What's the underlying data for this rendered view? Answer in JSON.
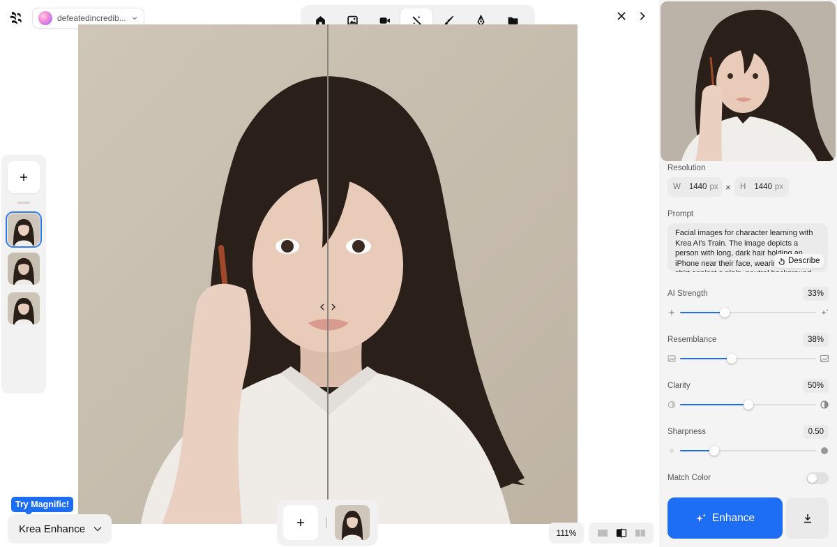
{
  "workspace": {
    "name": "defeatedincredib..."
  },
  "toolbar": {
    "tools": [
      {
        "icon": "home-icon",
        "active": false
      },
      {
        "icon": "image-icon",
        "active": false
      },
      {
        "icon": "video-icon",
        "active": false
      },
      {
        "icon": "enhance-wand-icon",
        "active": true
      },
      {
        "icon": "brush-icon",
        "active": false
      },
      {
        "icon": "pen-tool-icon",
        "active": false
      },
      {
        "icon": "folder-icon",
        "active": false
      }
    ]
  },
  "canvas": {
    "zoom": "111%",
    "compare_split": 0.5
  },
  "promo": {
    "badge": "Try Magnific!"
  },
  "model": {
    "selected": "Krea Enhance"
  },
  "panel": {
    "resolution_label": "Resolution",
    "width_key": "W",
    "width_value": "1440",
    "width_unit": "px",
    "height_key": "H",
    "height_value": "1440",
    "height_unit": "px",
    "times": "×",
    "prompt_label": "Prompt",
    "prompt_text": "Facial images for character learning with Krea AI's Train. The image depicts a person with long, dark hair holding an iPhone near their face, wearing a white shirt against a plain, neutral background.",
    "describe_label": "Describe",
    "sliders": [
      {
        "label": "AI Strength",
        "value_text": "33%",
        "value": 0.33
      },
      {
        "label": "Resemblance",
        "value_text": "38%",
        "value": 0.38
      },
      {
        "label": "Clarity",
        "value_text": "50%",
        "value": 0.5
      },
      {
        "label": "Sharpness",
        "value_text": "0.50",
        "value": 0.25
      }
    ],
    "match_color_label": "Match Color",
    "match_color_on": false,
    "enhance_label": "Enhance"
  },
  "colors": {
    "accent": "#1e6df5",
    "panel_bg": "#f4f4f4",
    "toolbar_bg": "#f1f1f1"
  }
}
